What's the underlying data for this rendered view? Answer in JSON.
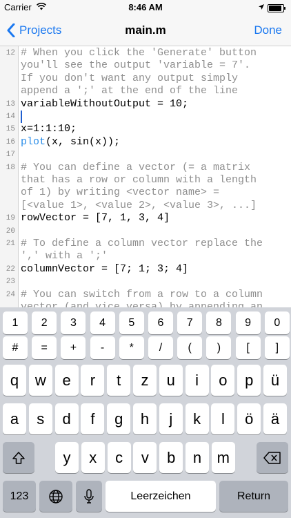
{
  "status_bar": {
    "carrier": "Carrier",
    "time": "8:46 AM"
  },
  "nav": {
    "back_label": "Projects",
    "title": "main.m",
    "done_label": "Done"
  },
  "editor": {
    "lines": [
      {
        "num": "12",
        "text": "# When you click the 'Generate' button",
        "comment": true
      },
      {
        "num": "",
        "text": "you'll see the output 'variable = 7'.",
        "comment": true
      },
      {
        "num": "",
        "text": "If you don't want any output simply",
        "comment": true
      },
      {
        "num": "",
        "text": "append a ';' at the end of the line",
        "comment": true
      },
      {
        "num": "13",
        "text": "variableWithoutOutput = 10;",
        "comment": false
      },
      {
        "num": "14",
        "text": "",
        "comment": false
      },
      {
        "num": "15",
        "text": "x=1:1:10;",
        "comment": false
      },
      {
        "num": "16",
        "text": "plot(x, sin(x));",
        "comment": false,
        "fn": "plot"
      },
      {
        "num": "17",
        "text": "",
        "comment": false
      },
      {
        "num": "18",
        "text": "# You can define a vector (= a matrix",
        "comment": true
      },
      {
        "num": "",
        "text": "that has a row or column with a length",
        "comment": true
      },
      {
        "num": "",
        "text": "of 1) by writing <vector name> =",
        "comment": true
      },
      {
        "num": "",
        "text": "[<value 1>, <value 2>, <value 3>, ...]",
        "comment": true
      },
      {
        "num": "19",
        "text": "rowVector = [7, 1, 3, 4]",
        "comment": false
      },
      {
        "num": "20",
        "text": "",
        "comment": false
      },
      {
        "num": "21",
        "text": "# To define a column vector replace the",
        "comment": true
      },
      {
        "num": "",
        "text": "',' with a ';'",
        "comment": true
      },
      {
        "num": "22",
        "text": "columnVector = [7; 1; 3; 4]",
        "comment": false
      },
      {
        "num": "23",
        "text": "",
        "comment": false
      },
      {
        "num": "24",
        "text": "# You can switch from a row to a column",
        "comment": true
      },
      {
        "num": "",
        "text": "vector (and vice versa) by appending an",
        "comment": true
      }
    ]
  },
  "keyboard": {
    "number_row": [
      "1",
      "2",
      "3",
      "4",
      "5",
      "6",
      "7",
      "8",
      "9",
      "0"
    ],
    "symbol_row": [
      "#",
      "=",
      "+",
      "-",
      "*",
      "/",
      "(",
      ")",
      "[",
      "]"
    ],
    "row1": [
      "q",
      "w",
      "e",
      "r",
      "t",
      "z",
      "u",
      "i",
      "o",
      "p",
      "ü"
    ],
    "row2": [
      "a",
      "s",
      "d",
      "f",
      "g",
      "h",
      "j",
      "k",
      "l",
      "ö",
      "ä"
    ],
    "row3": [
      "y",
      "x",
      "c",
      "v",
      "b",
      "n",
      "m"
    ],
    "mode_key": "123",
    "space_label": "Leerzeichen",
    "return_label": "Return",
    "icons": {
      "shift": "shift-icon",
      "delete": "backspace-icon",
      "globe": "globe-icon",
      "mic": "microphone-icon"
    }
  }
}
